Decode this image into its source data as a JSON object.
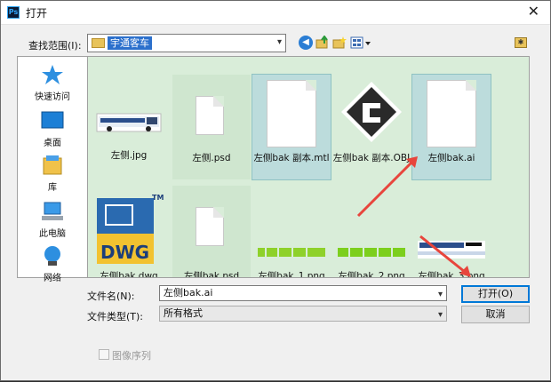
{
  "window": {
    "app_icon": "Ps",
    "title": "打开",
    "close_glyph": "✕"
  },
  "lookin": {
    "label": "查找范围(I):",
    "value": "宇通客车"
  },
  "toolbar": {
    "back": "back-icon",
    "up": "up-folder-icon",
    "new_folder": "new-folder-icon",
    "view": "view-menu-icon"
  },
  "places": [
    {
      "label": "快速访问",
      "icon": "star-icon"
    },
    {
      "label": "桌面",
      "icon": "desktop-icon"
    },
    {
      "label": "库",
      "icon": "library-icon"
    },
    {
      "label": "此电脑",
      "icon": "computer-icon"
    },
    {
      "label": "网络",
      "icon": "network-icon"
    }
  ],
  "files": [
    {
      "name": "左侧.jpg",
      "type": "image-bus"
    },
    {
      "name": "左侧.psd",
      "type": "document"
    },
    {
      "name": "左侧bak 副本.mtl",
      "type": "document"
    },
    {
      "name": "左侧bak 副本.OBJ",
      "type": "obj-file"
    },
    {
      "name": "左侧bak.ai",
      "type": "document",
      "selected": true
    },
    {
      "name": "左侧bak.dwg",
      "type": "dwg-file"
    },
    {
      "name": "左侧bak.psd",
      "type": "document"
    },
    {
      "name": "左侧bak_1.png",
      "type": "image-strip"
    },
    {
      "name": "左侧bak_2.png",
      "type": "image-strip"
    },
    {
      "name": "左侧bak_3.png",
      "type": "image-bus-small"
    }
  ],
  "filename": {
    "label": "文件名(N):",
    "value": "左侧bak.ai"
  },
  "filetype": {
    "label": "文件类型(T):",
    "value": "所有格式"
  },
  "buttons": {
    "open": "打开(O)",
    "cancel": "取消"
  },
  "image_sequence": {
    "label": "图像序列",
    "checked": false
  },
  "colors": {
    "accent": "#2c70cc",
    "list_bg": "#d9edd9",
    "annotation_arrow": "#e8453c"
  }
}
